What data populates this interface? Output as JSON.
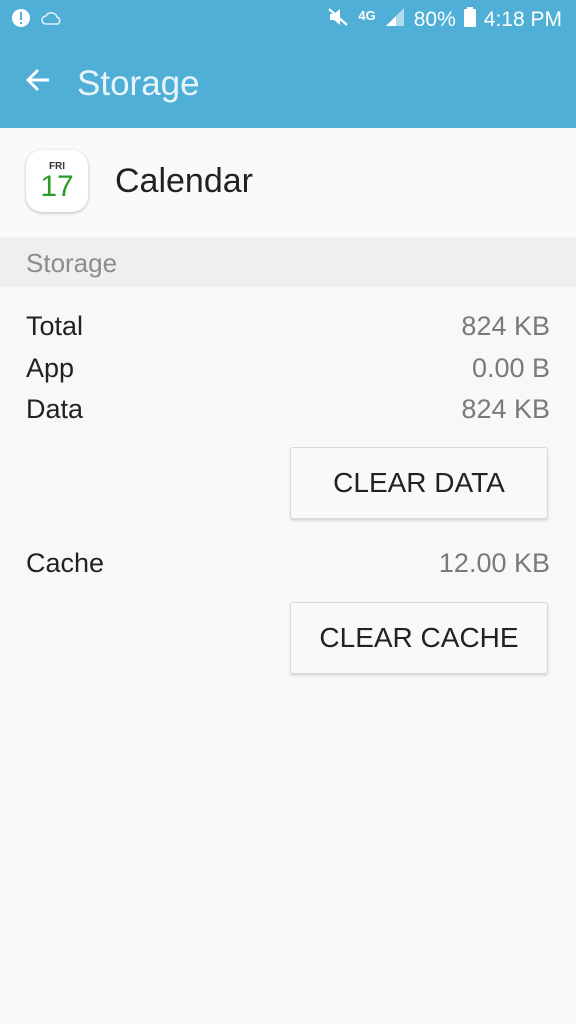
{
  "status_bar": {
    "battery": "80%",
    "time": "4:18 PM",
    "network": "4G",
    "icons": [
      "alert-icon",
      "cloud-icon",
      "mute-icon",
      "network-icon",
      "signal-icon",
      "battery-icon"
    ]
  },
  "app_bar": {
    "title": "Storage",
    "back_icon": "arrow-left-icon",
    "color": "#4fafd6"
  },
  "app": {
    "name": "Calendar",
    "icon_day": "FRI",
    "icon_date": "17",
    "icon_date_color": "#2a9b2a"
  },
  "section": {
    "title": "Storage"
  },
  "storage": {
    "rows": [
      {
        "label": "Total",
        "value": "824 KB"
      },
      {
        "label": "App",
        "value": "0.00 B"
      },
      {
        "label": "Data",
        "value": "824 KB"
      }
    ],
    "clear_data_label": "CLEAR DATA",
    "cache_label": "Cache",
    "cache_value": "12.00 KB",
    "clear_cache_label": "CLEAR CACHE"
  }
}
